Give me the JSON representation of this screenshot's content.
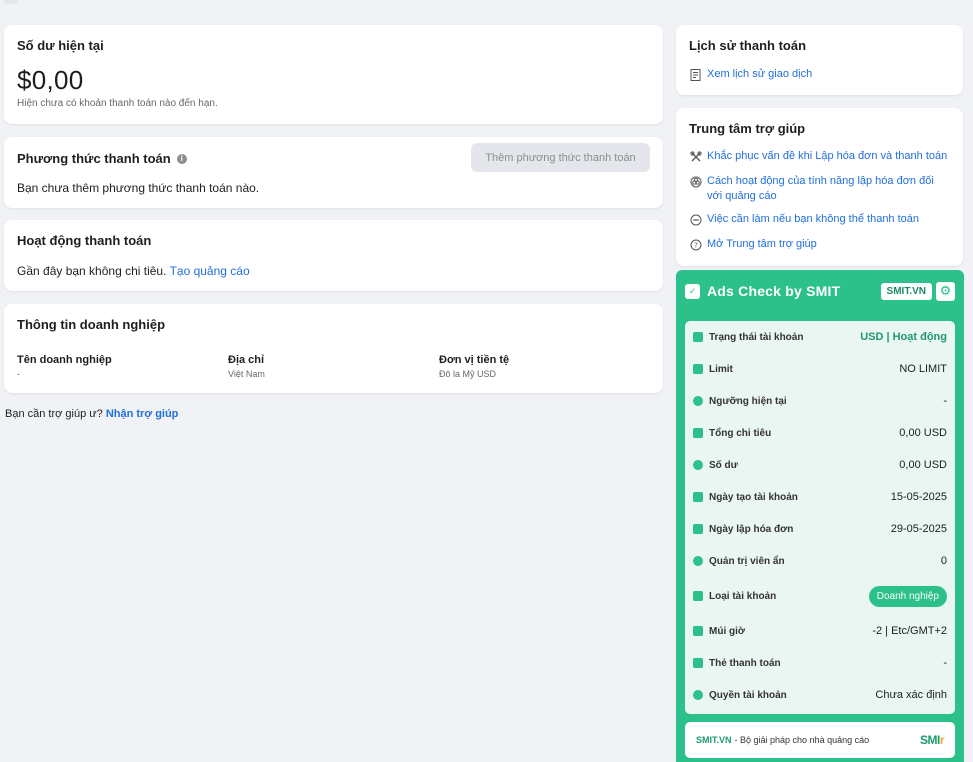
{
  "balance": {
    "title": "Số dư hiện tại",
    "amount": "$0,00",
    "note": "Hiện chưa có khoản thanh toán nào đến hạn."
  },
  "payment_method": {
    "title": "Phương thức thanh toán",
    "add_button": "Thêm phương thức thanh toán",
    "empty": "Bạn chưa thêm phương thức thanh toán nào."
  },
  "activity": {
    "title": "Hoạt động thanh toán",
    "text": "Gần đây bạn không chi tiêu.",
    "link": "Tạo quảng cáo"
  },
  "business": {
    "title": "Thông tin doanh nghiệp",
    "columns": [
      {
        "label": "Tên doanh nghiệp",
        "value": "-"
      },
      {
        "label": "Địa chỉ",
        "value": "Việt Nam"
      },
      {
        "label": "Đơn vị tiền tệ",
        "value": "Đô la Mỹ USD"
      }
    ]
  },
  "help_line": {
    "text": "Bạn cần trợ giúp ư?",
    "link": "Nhận trợ giúp"
  },
  "history": {
    "title": "Lịch sử thanh toán",
    "link": "Xem lịch sử giao dịch",
    "icon": "receipt-icon"
  },
  "help_center": {
    "title": "Trung tâm trợ giúp",
    "links": [
      {
        "label": "Khắc phục vấn đề khi Lập hóa đơn và thanh toán",
        "icon": "tools-icon"
      },
      {
        "label": "Cách hoạt động của tính năng lập hóa đơn đối với quảng cáo",
        "icon": "coins-icon"
      },
      {
        "label": "Việc cần làm nếu bạn không thể thanh toán",
        "icon": "minus-circle-icon"
      },
      {
        "label": "Mở Trung tâm trợ giúp",
        "icon": "question-circle-icon"
      }
    ]
  },
  "ads_check": {
    "title": "Ads Check by SMIT",
    "badge": "SMIT.VN",
    "accent": "#2cc08a",
    "rows": [
      {
        "key": "Trạng thái tài khoản",
        "value": "USD | Hoạt động"
      },
      {
        "key": "Limit",
        "value": "NO LIMIT"
      },
      {
        "key": "Ngưỡng hiện tại",
        "value": "-"
      },
      {
        "key": "Tổng chi tiêu",
        "value": "0,00 USD"
      },
      {
        "key": "Số dư",
        "value": "0,00 USD"
      },
      {
        "key": "Ngày tạo tài khoản",
        "value": "15-05-2025"
      },
      {
        "key": "Ngày lập hóa đơn",
        "value": "29-05-2025"
      },
      {
        "key": "Quản trị viên ẩn",
        "value": "0"
      },
      {
        "key": "Loại tài khoản",
        "value": "Doanh nghiệp"
      },
      {
        "key": "Múi giờ",
        "value": "-2 | Etc/GMT+2"
      },
      {
        "key": "Thẻ thanh toán",
        "value": "-"
      },
      {
        "key": "Quyền tài khoản",
        "value": "Chưa xác định"
      }
    ],
    "footer": {
      "brand": "SMIT.VN",
      "text": "- Bộ giải pháp cho nhà quảng cáo",
      "logo_main": "SMI",
      "logo_accent": "r"
    }
  }
}
